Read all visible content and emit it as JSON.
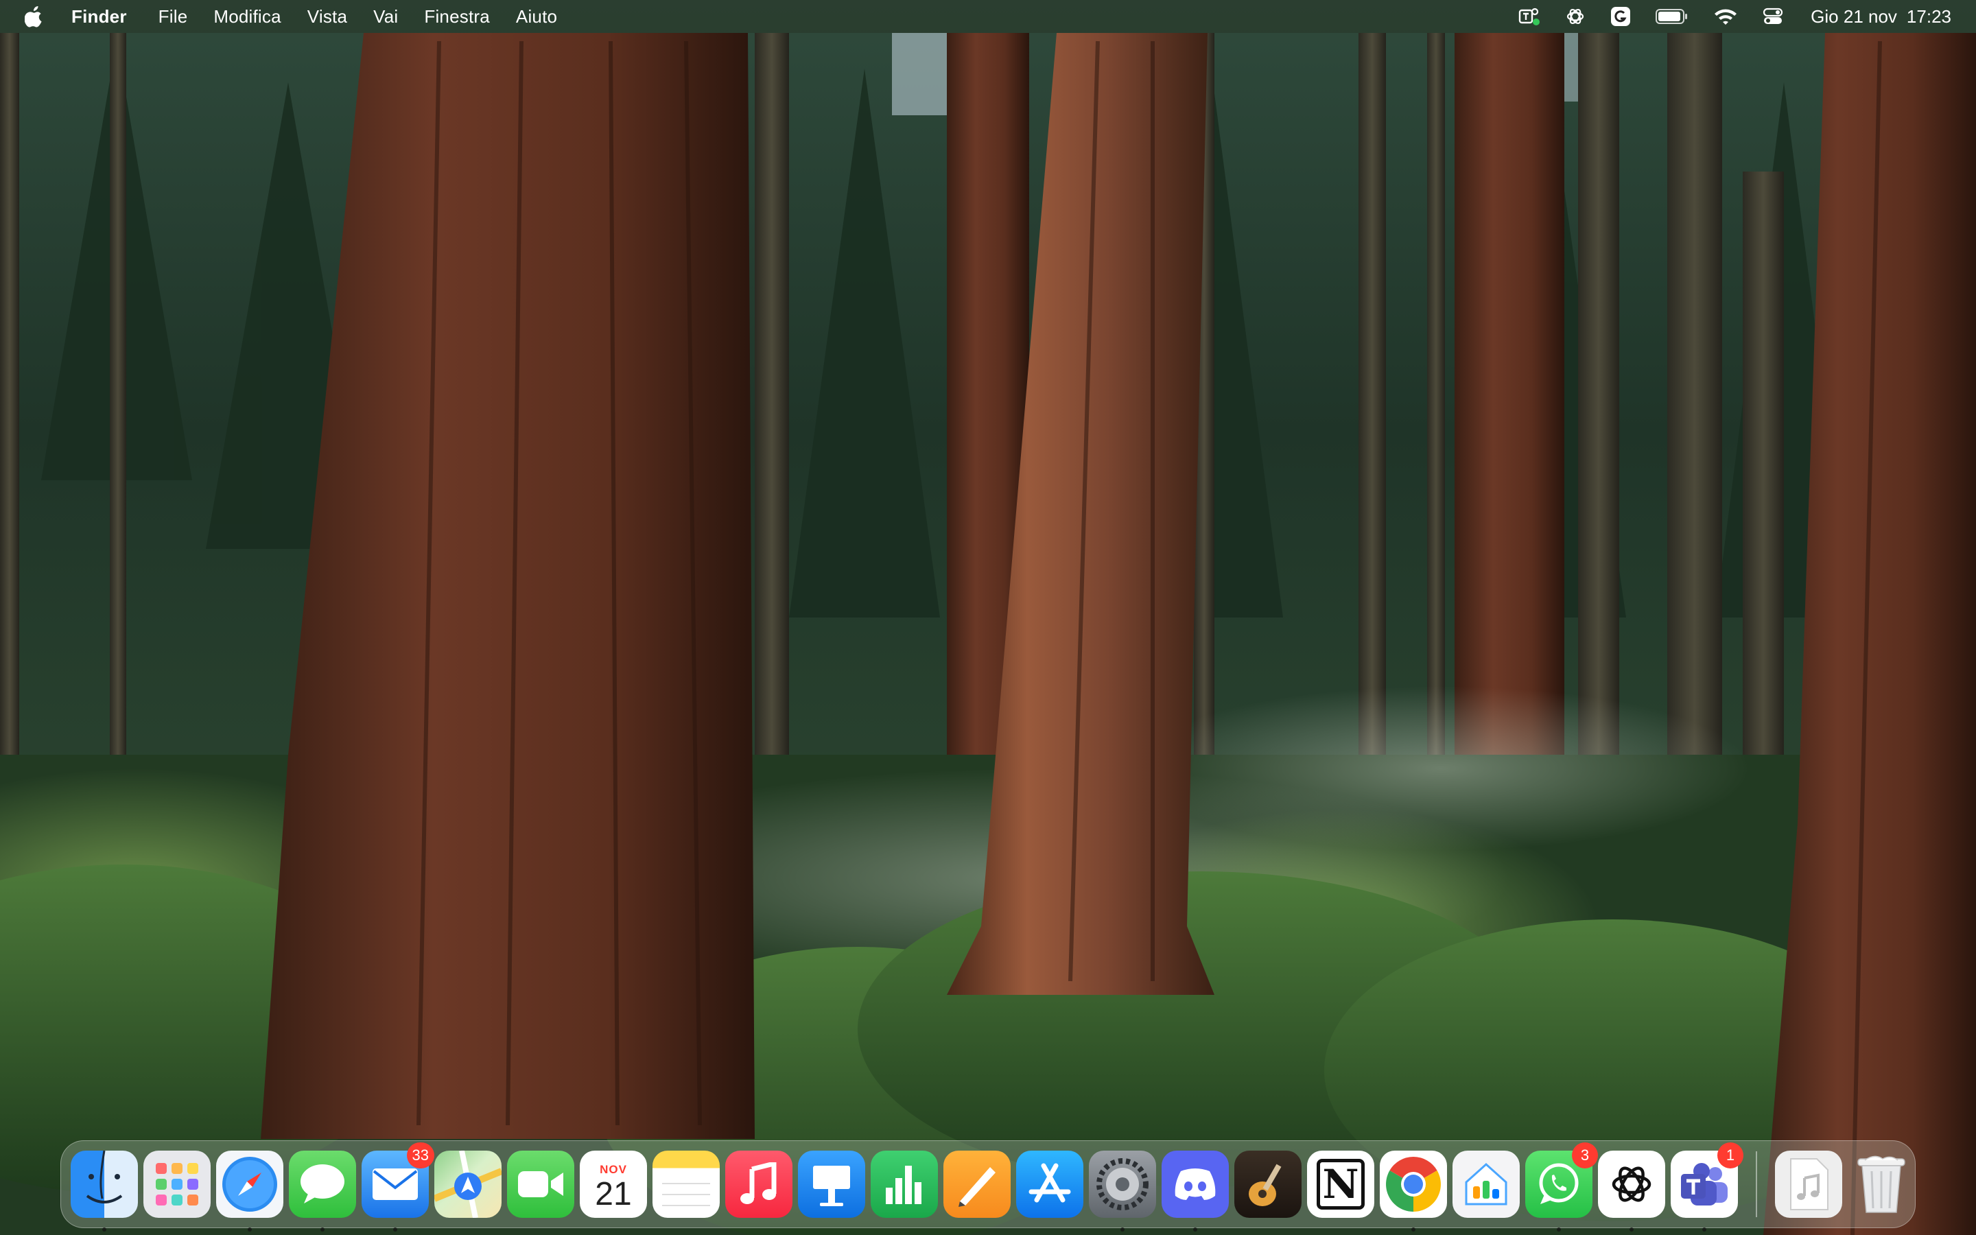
{
  "menubar": {
    "apple_icon": "apple-logo",
    "app_name": "Finder",
    "menus": [
      "File",
      "Modifica",
      "Vista",
      "Vai",
      "Finestra",
      "Aiuto"
    ],
    "status_icons": [
      "teams-status-icon",
      "chatgpt-icon",
      "grammarly-icon",
      "battery-icon",
      "wifi-icon",
      "control-center-icon"
    ],
    "date": "Gio 21 nov",
    "time": "17:23"
  },
  "dock": {
    "apps": [
      {
        "name": "Finder",
        "icon": "finder-icon",
        "running": true
      },
      {
        "name": "Launchpad",
        "icon": "launchpad-icon",
        "running": false
      },
      {
        "name": "Safari",
        "icon": "safari-icon",
        "running": true
      },
      {
        "name": "Messaggi",
        "icon": "messages-icon",
        "running": true
      },
      {
        "name": "Mail",
        "icon": "mail-icon",
        "running": true,
        "badge": "33"
      },
      {
        "name": "Mappe",
        "icon": "maps-icon",
        "running": false
      },
      {
        "name": "FaceTime",
        "icon": "facetime-icon",
        "running": false
      },
      {
        "name": "Calendario",
        "icon": "calendar-icon",
        "running": false,
        "month": "NOV",
        "day": "21"
      },
      {
        "name": "Note",
        "icon": "notes-icon",
        "running": false
      },
      {
        "name": "Musica",
        "icon": "music-icon",
        "running": false
      },
      {
        "name": "Keynote",
        "icon": "keynote-icon",
        "running": false
      },
      {
        "name": "Numbers",
        "icon": "numbers-icon",
        "running": false
      },
      {
        "name": "Pages",
        "icon": "pages-icon",
        "running": false
      },
      {
        "name": "App Store",
        "icon": "app-store-icon",
        "running": false
      },
      {
        "name": "Impostazioni di Sistema",
        "icon": "system-settings-icon",
        "running": true
      },
      {
        "name": "Discord",
        "icon": "discord-icon",
        "running": true
      },
      {
        "name": "GarageBand",
        "icon": "garageband-icon",
        "running": false
      },
      {
        "name": "Notion",
        "icon": "notion-icon",
        "running": false
      },
      {
        "name": "Google Chrome",
        "icon": "chrome-icon",
        "running": true
      },
      {
        "name": "Casa",
        "icon": "home-icon",
        "running": false
      },
      {
        "name": "WhatsApp",
        "icon": "whatsapp-icon",
        "running": true,
        "badge": "3"
      },
      {
        "name": "ChatGPT",
        "icon": "chatgpt-icon",
        "running": true
      },
      {
        "name": "Microsoft Teams",
        "icon": "teams-icon",
        "running": true,
        "badge": "1"
      }
    ],
    "stack": {
      "name": "Documento musica",
      "icon": "music-document-icon"
    },
    "trash": {
      "name": "Cestino",
      "icon": "trash-icon"
    }
  },
  "colors": {
    "menubar_bg": "#28342690",
    "badge": "#ff3b30"
  }
}
